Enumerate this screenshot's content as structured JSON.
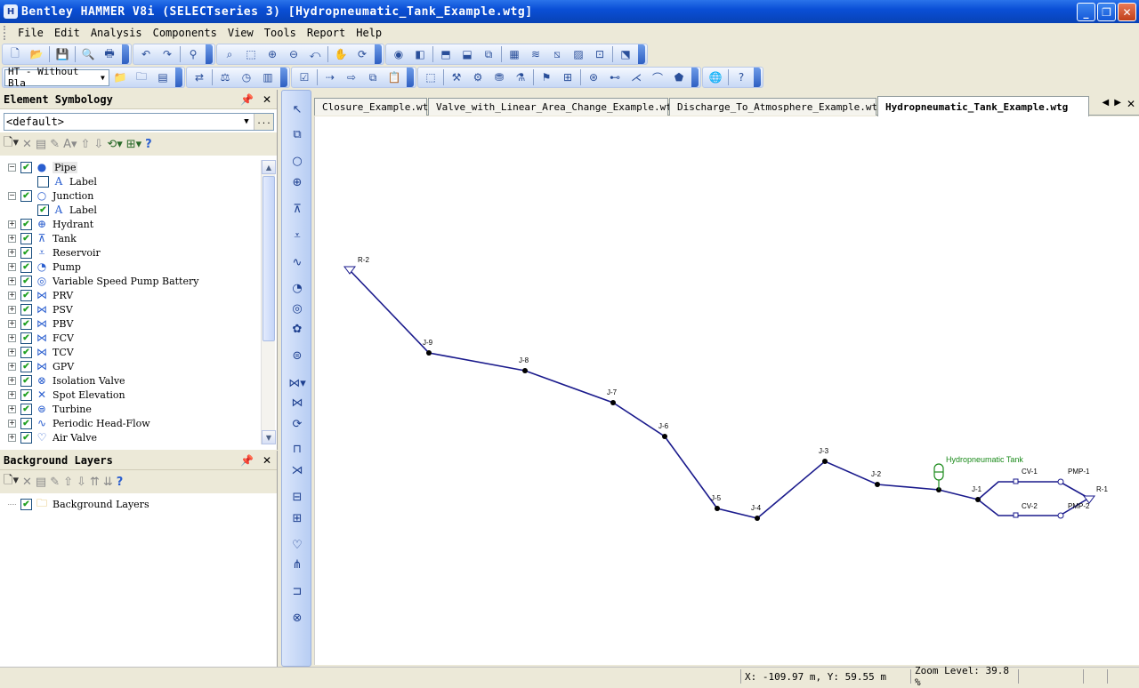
{
  "window": {
    "title": "Bentley HAMMER V8i (SELECTseries 3) [Hydropneumatic_Tank_Example.wtg]"
  },
  "menu": [
    "File",
    "Edit",
    "Analysis",
    "Components",
    "View",
    "Tools",
    "Report",
    "Help"
  ],
  "toolbar": {
    "scenario_combo": "HT - Without Bla"
  },
  "element_symbology": {
    "title": "Element Symbology",
    "combo_value": "<default>",
    "combo_button": "...",
    "tree": [
      {
        "label": "Pipe",
        "icon": "pipe-icon",
        "checked": true,
        "expander": "-",
        "child": false
      },
      {
        "label": "Label",
        "icon": "label-icon",
        "checked": false,
        "expander": "",
        "child": true
      },
      {
        "label": "Junction",
        "icon": "junction-icon",
        "checked": true,
        "expander": "-",
        "child": false
      },
      {
        "label": "Label",
        "icon": "label-icon",
        "checked": true,
        "expander": "",
        "child": true
      },
      {
        "label": "Hydrant",
        "icon": "hydrant-icon",
        "checked": true,
        "expander": "+",
        "child": false
      },
      {
        "label": "Tank",
        "icon": "tank-icon",
        "checked": true,
        "expander": "+",
        "child": false
      },
      {
        "label": "Reservoir",
        "icon": "reservoir-icon",
        "checked": true,
        "expander": "+",
        "child": false
      },
      {
        "label": "Pump",
        "icon": "pump-icon",
        "checked": true,
        "expander": "+",
        "child": false
      },
      {
        "label": "Variable Speed Pump Battery",
        "icon": "vspb-icon",
        "checked": true,
        "expander": "+",
        "child": false
      },
      {
        "label": "PRV",
        "icon": "valve-icon",
        "checked": true,
        "expander": "+",
        "child": false
      },
      {
        "label": "PSV",
        "icon": "valve-icon",
        "checked": true,
        "expander": "+",
        "child": false
      },
      {
        "label": "PBV",
        "icon": "valve-icon",
        "checked": true,
        "expander": "+",
        "child": false
      },
      {
        "label": "FCV",
        "icon": "valve-icon",
        "checked": true,
        "expander": "+",
        "child": false
      },
      {
        "label": "TCV",
        "icon": "valve-icon",
        "checked": true,
        "expander": "+",
        "child": false
      },
      {
        "label": "GPV",
        "icon": "valve-icon",
        "checked": true,
        "expander": "+",
        "child": false
      },
      {
        "label": "Isolation Valve",
        "icon": "isolation-valve-icon",
        "checked": true,
        "expander": "+",
        "child": false
      },
      {
        "label": "Spot Elevation",
        "icon": "spot-elevation-icon",
        "checked": true,
        "expander": "+",
        "child": false
      },
      {
        "label": "Turbine",
        "icon": "turbine-icon",
        "checked": true,
        "expander": "+",
        "child": false
      },
      {
        "label": "Periodic Head-Flow",
        "icon": "periodic-head-flow-icon",
        "checked": true,
        "expander": "+",
        "child": false
      },
      {
        "label": "Air Valve",
        "icon": "air-valve-icon",
        "checked": true,
        "expander": "+",
        "child": false
      }
    ]
  },
  "background_layers": {
    "title": "Background Layers",
    "tree": [
      {
        "label": "Background Layers",
        "checked": true
      }
    ]
  },
  "tabs": [
    {
      "label": "Closure_Example.wtg",
      "active": false
    },
    {
      "label": "Valve_with_Linear_Area_Change_Example.wtg",
      "active": false
    },
    {
      "label": "Discharge_To_Atmosphere_Example.wtg",
      "active": false
    },
    {
      "label": "Hydropneumatic_Tank_Example.wtg",
      "active": true
    }
  ],
  "network": {
    "line_color": "#1a1a8c",
    "node_labels": [
      "R-2",
      "J-9",
      "J-8",
      "J-7",
      "J-6",
      "J-5",
      "J-4",
      "J-3",
      "J-2",
      "J-1",
      "CV-1",
      "CV-2",
      "PMP-1",
      "PMP-2",
      "R-1"
    ],
    "tank_label": "Hydropneumatic Tank",
    "tank_color": "#1a8a1a"
  },
  "status": {
    "coords": "X: -109.97 m, Y: 59.55 m",
    "zoom": "Zoom Level: 39.8 %"
  }
}
